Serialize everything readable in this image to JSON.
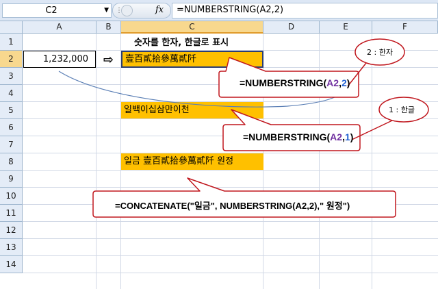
{
  "name_box": {
    "value": "C2"
  },
  "formula_bar": {
    "fx": "fx",
    "formula": "=NUMBERSTRING(A2,2)"
  },
  "columns": [
    "A",
    "B",
    "C",
    "D",
    "E",
    "F"
  ],
  "rows": [
    "1",
    "2",
    "3",
    "4",
    "5",
    "6",
    "7",
    "8",
    "9",
    "10",
    "11",
    "12",
    "13",
    "14"
  ],
  "cells": {
    "a2": "1,232,000",
    "b2_arrow": "⇨",
    "c1": "숫자를 한자, 한글로 표시",
    "c2": "壹百貳拾參萬貳阡",
    "c5": "일백이십삼만이천",
    "c8": "일금 壹百貳拾參萬貳阡 원정"
  },
  "callouts": {
    "c2": {
      "prefix": "=NUMBERSTRING(",
      "ref": "A2",
      "comma": ",",
      "arg": "2",
      "suffix": ")"
    },
    "c5": {
      "prefix": "=NUMBERSTRING(",
      "ref": "A2",
      "comma": ",",
      "arg": "1",
      "suffix": ")"
    },
    "c8": {
      "text": "=CONCATENATE(\"일금\", NUMBERSTRING(A2,2),\" 원정\")"
    }
  },
  "bubbles": {
    "hanja": "2 : 한자",
    "hangul": "1 : 한글"
  },
  "colors": {
    "orange_fill": "#ffc000",
    "callout_border": "#c0161d",
    "ref_color": "#7030a0",
    "arg_color": "#1f5fd1"
  }
}
